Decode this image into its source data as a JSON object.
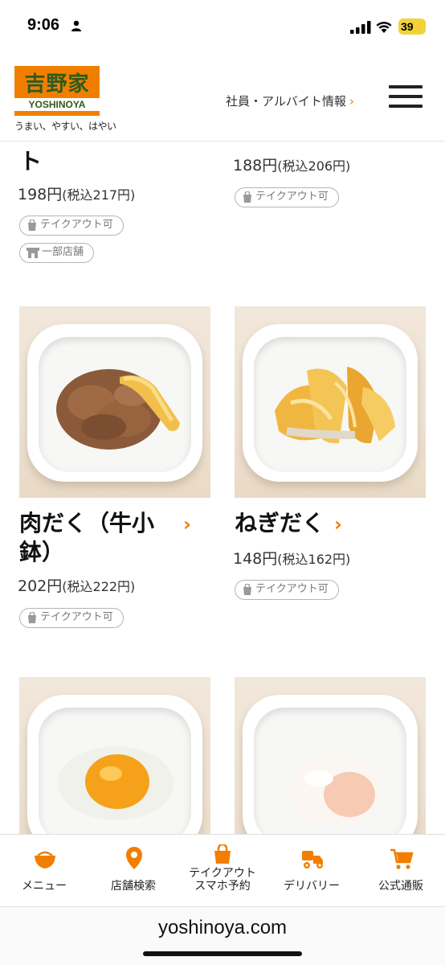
{
  "status_bar": {
    "time": "9:06",
    "battery": "39"
  },
  "header": {
    "logo_kanji": "吉野家",
    "logo_en": "YOSHINOYA",
    "tagline": "うまい、やすい、はやい",
    "recruit_link": "社員・アルバイト情報",
    "accent": "#f07f00",
    "icons": {
      "menu": "hamburger-icon",
      "link": "chevron-right-icon"
    }
  },
  "menu_items": [
    {
      "title": "ト",
      "price": "198円",
      "price_tax": "(税込217円)",
      "badges": [
        {
          "label": "テイクアウト可",
          "icon": "takeout-bag-icon"
        },
        {
          "label": "一部店舗",
          "icon": "store-icon"
        }
      ]
    },
    {
      "title": "",
      "price": "188円",
      "price_tax": "(税込206円)",
      "badges": [
        {
          "label": "テイクアウト可",
          "icon": "takeout-bag-icon"
        }
      ]
    },
    {
      "title_line1": "肉だく（牛小",
      "title_line2": "鉢）",
      "price": "202円",
      "price_tax": "(税込222円)",
      "badges": [
        {
          "label": "テイクアウト可",
          "icon": "takeout-bag-icon"
        }
      ]
    },
    {
      "title": "ねぎだく",
      "price": "148円",
      "price_tax": "(税込162円)",
      "badges": [
        {
          "label": "テイクアウト可",
          "icon": "takeout-bag-icon"
        }
      ]
    }
  ],
  "chevron": "›",
  "bottom_nav": [
    {
      "label": "メニュー",
      "icon": "bowl-icon"
    },
    {
      "label": "店舗検索",
      "icon": "location-pin-icon"
    },
    {
      "label_line1": "テイクアウト",
      "label_line2": "スマホ予約",
      "icon": "takeout-bag-icon"
    },
    {
      "label": "デリバリー",
      "icon": "delivery-bike-icon"
    },
    {
      "label": "公式通販",
      "icon": "cart-icon"
    }
  ],
  "browser": {
    "url": "yoshinoya.com"
  }
}
